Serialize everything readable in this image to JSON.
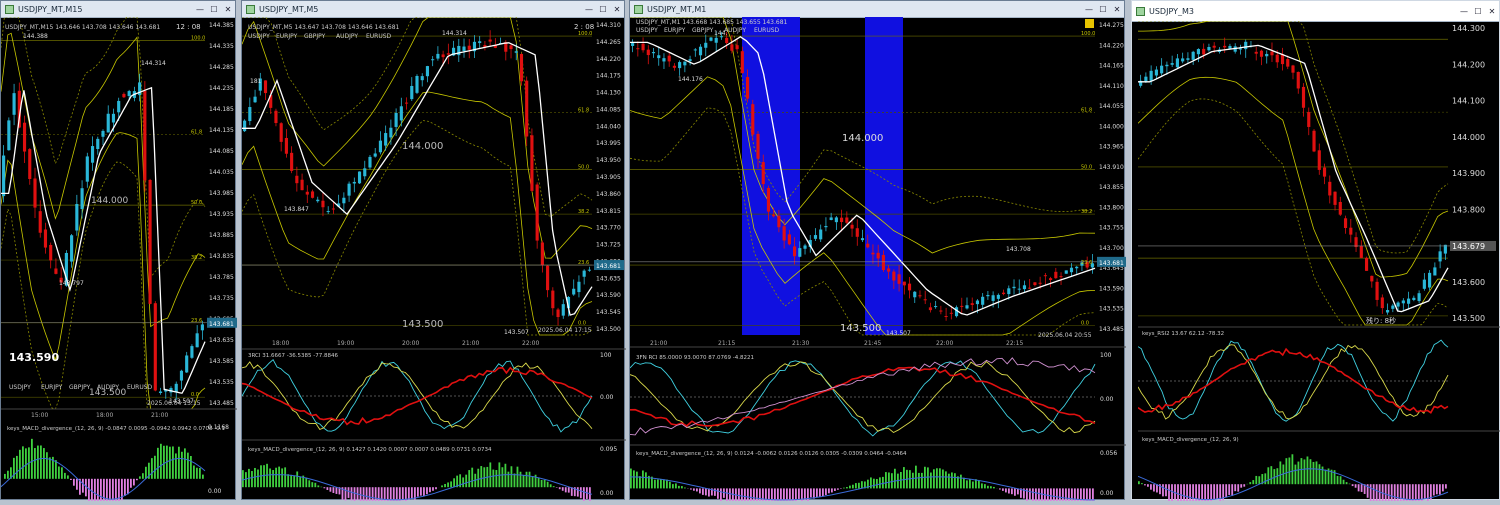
{
  "windows": [
    {
      "title": "USDJPY_MT,M15",
      "header_text": "USDJPY_MT,M15  143.646 143.708 143.646 143.681",
      "clock": "12 : 08",
      "price_scale": [
        "144.385",
        "144.335",
        "144.285",
        "144.235",
        "144.185",
        "144.135",
        "144.085",
        "144.035",
        "143.985",
        "143.935",
        "143.885",
        "143.835",
        "143.785",
        "143.735",
        "143.685",
        "143.635",
        "143.585",
        "143.535",
        "143.485"
      ],
      "current_price_tag": "143.681",
      "time_labels": [
        "15:00",
        "18:00",
        "21:00"
      ],
      "big_price": "143.590",
      "level_labels": [
        "144.000",
        "143.500"
      ],
      "swing_labels": [
        "144.388",
        "144.314",
        "143.797",
        "143.507"
      ],
      "fib_labels": [
        "100.0",
        "61.8",
        "50.0",
        "38.2",
        "23.6",
        "0.0"
      ],
      "symbols": [
        "USDJPY",
        "EURJPY",
        "GBPJPY",
        "AUDJPY",
        "EURUSD"
      ],
      "timestamp": "2025.06.04 13:15",
      "indicator_label": "keys_MACD_divergence_(12, 26, 9) -0.0847 0.0095 -0.0942 0.0942 0.0708 -0.1",
      "indicator_scale": [
        "0.1168",
        "0.00"
      ]
    },
    {
      "title": "USDJPY_MT,M5",
      "header_text": "USDJPY_MT,M5  143.647 143.708 143.646 143.681",
      "clock": "2 : 08",
      "price_scale": [
        "144.310",
        "144.265",
        "144.220",
        "144.175",
        "144.130",
        "144.085",
        "144.040",
        "143.995",
        "143.950",
        "143.905",
        "143.860",
        "143.815",
        "143.770",
        "143.725",
        "143.680",
        "143.635",
        "143.590",
        "143.545",
        "143.500"
      ],
      "current_price_tag": "143.681",
      "level_tag": "144.000",
      "bottom_tag": "143.500",
      "time_labels": [
        "18:00",
        "19:00",
        "20:00",
        "21:00",
        "22:00"
      ],
      "level_labels": [
        "144.000",
        "143.500"
      ],
      "swing_labels": [
        "181",
        "144.314",
        "143.847",
        "143.507"
      ],
      "fib_labels": [
        "100.0",
        "61.8",
        "50.0",
        "38.2",
        "23.6",
        "0.0"
      ],
      "symbols": [
        "USDJPY",
        "EURJPY",
        "GBPJPY",
        "AUDJPY",
        "EURUSD"
      ],
      "timestamp": "2025.06.04 17:15",
      "rci_label": "3RCI 31.6667 -36.5385 -77.8846",
      "rci_scale": [
        "100",
        "0.00",
        "-100.0000"
      ],
      "indicator_label": "keys_MACD_divergence_(12, 26, 9) 0.1427 0.1420 0.0007 0.0007 0.0489 0.0731 0.0734",
      "indicator_scale": [
        "0.095",
        "0.00"
      ]
    },
    {
      "title": "USDJPY_MT,M1",
      "header_text": "USDJPY_MT,M1  143.668 143.685 143.655 143.681",
      "symbols": [
        "USDJPY",
        "EURJPY",
        "GBPJPY",
        "AUDJPY",
        "EURUSD"
      ],
      "price_scale": [
        "144.275",
        "144.220",
        "144.165",
        "144.110",
        "144.055",
        "144.000",
        "143.965",
        "143.910",
        "143.855",
        "143.800",
        "143.755",
        "143.700",
        "143.645",
        "143.590",
        "143.535",
        "143.485"
      ],
      "current_price_tag": "143.681",
      "level_tag": "144.000",
      "time_labels": [
        "21:00",
        "21:15",
        "21:30",
        "21:45",
        "22:00",
        "22:15"
      ],
      "level_labels": [
        "144.000",
        "143.500"
      ],
      "swing_labels": [
        "144.176",
        "144.",
        "143.708",
        "143.507"
      ],
      "fib_labels": [
        "100.0",
        "61.8",
        "50.0",
        "38.2",
        "23.6",
        "0.0"
      ],
      "timestamp": "2025.06.04 20:55",
      "rci_label": "3FN RCI 85.0000 93.0070 87.0769 -4.8221",
      "rci_scale": [
        "100",
        "0.00",
        "-100.0000"
      ],
      "indicator_label": "keys_MACD_divergence_(12, 26, 9) 0.0124 -0.0062 0.0126 0.0126 0.0305 -0.0309 0.0464 -0.0464",
      "indicator_scale": [
        "0.056",
        "0.00"
      ]
    },
    {
      "title": "USDJPY_M3",
      "price_scale": [
        "144.300",
        "144.200",
        "144.100",
        "144.000",
        "143.900",
        "143.800",
        "143.700",
        "143.600",
        "143.500"
      ],
      "current_price_tag": "143.679",
      "remaining": "残り: 8秒",
      "rsi_label": "keys_RSI2 13.67 62.12 -78.32",
      "indicator_label": "keys_MACD_divergence_(12, 26, 9)"
    }
  ],
  "colors": {
    "bull_candle": "#2ab7d8",
    "bear_candle": "#e01010",
    "bollinger": "#c8c800",
    "ma_white": "#ffffff",
    "highlight_zone": "#1010e0",
    "macd_pos": "#3fcf3f",
    "macd_neg": "#e080e0"
  }
}
